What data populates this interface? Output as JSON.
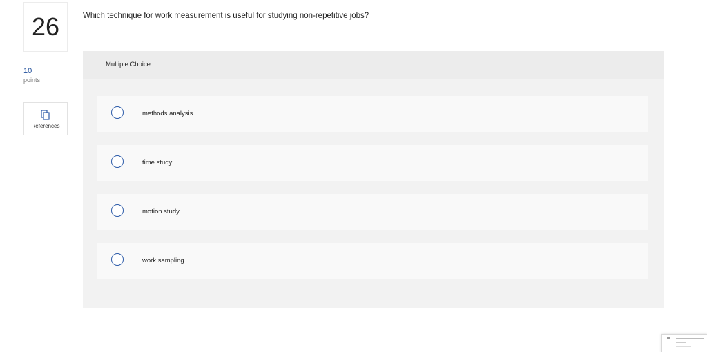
{
  "question_number": "26",
  "points": {
    "value": "10",
    "label": "points"
  },
  "references": {
    "label": "References",
    "icon": "copy-icon"
  },
  "question_text": "Which technique for work measurement is useful for studying non-repetitive jobs?",
  "mc": {
    "title": "Multiple Choice",
    "options": [
      {
        "label": "methods analysis."
      },
      {
        "label": "time study."
      },
      {
        "label": "motion study."
      },
      {
        "label": "work sampling."
      }
    ]
  },
  "colors": {
    "accent": "#2b5aa8",
    "points": "#1f4e9a",
    "panel": "#f2f2f2"
  }
}
